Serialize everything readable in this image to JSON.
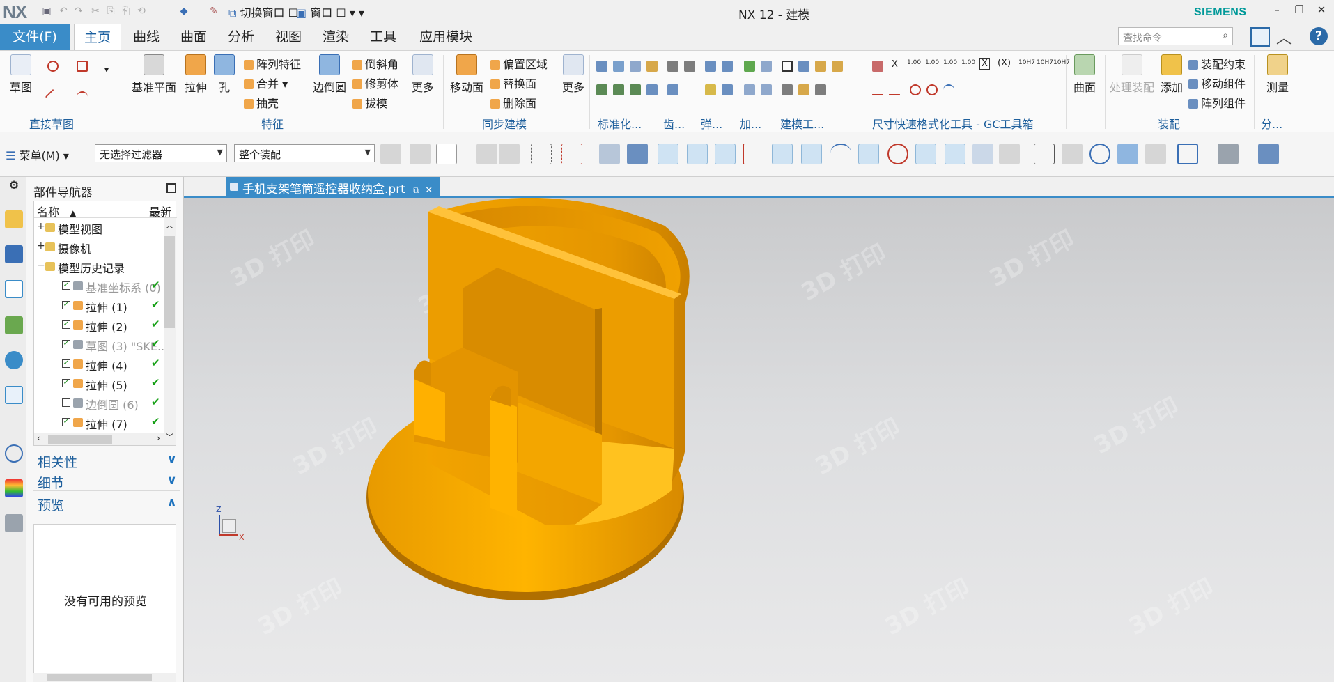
{
  "titlebar": {
    "logo": "NX",
    "switch_window": "切换窗口",
    "window_menu": "窗口",
    "title": "NX 12 - 建模",
    "brand": "SIEMENS"
  },
  "menu_tabs": {
    "file": "文件(F)",
    "tabs": [
      "主页",
      "曲线",
      "曲面",
      "分析",
      "视图",
      "渲染",
      "工具",
      "应用模块"
    ],
    "active": "主页",
    "search_placeholder": "查找命令"
  },
  "ribbon": {
    "groups": [
      "直接草图",
      "特征",
      "同步建模",
      "标准化...",
      "齿...",
      "弹...",
      "加...",
      "建模工...",
      "尺寸快速格式化工具 - GC工具箱",
      "装配",
      "分..."
    ],
    "sketch": "草图",
    "feature": {
      "datum_plane": "基准平面",
      "extrude": "拉伸",
      "hole": "孔",
      "pattern_feature": "阵列特征",
      "unite": "合并",
      "shell": "抽壳",
      "edge_blend": "边倒圆",
      "chamfer": "倒斜角",
      "trim_body": "修剪体",
      "draft": "拔模",
      "more": "更多"
    },
    "sync": {
      "move_face": "移动面",
      "offset_region": "偏置区域",
      "replace_face": "替换面",
      "delete_face": "删除面",
      "more": "更多"
    },
    "surface": "曲面",
    "assembly": {
      "process": "处理装配",
      "add": "添加",
      "constraint": "装配约束",
      "move_component": "移动组件",
      "pattern_component": "阵列组件"
    },
    "measure": "测量"
  },
  "toolbar2": {
    "menu": "菜单(M)",
    "filter": "无选择过滤器",
    "scope": "整个装配"
  },
  "navigator": {
    "title": "部件导航器",
    "col_name": "名称",
    "col_latest": "最新",
    "rows": [
      {
        "sign": "+",
        "label": "模型视图",
        "checked": null,
        "dim": false,
        "ok": false
      },
      {
        "sign": "+",
        "label": "摄像机",
        "checked": null,
        "dim": false,
        "ok": false
      },
      {
        "sign": "−",
        "label": "模型历史记录",
        "checked": null,
        "dim": false,
        "ok": false
      },
      {
        "sign": "",
        "label": "基准坐标系 (0)",
        "checked": true,
        "dim": true,
        "ok": true
      },
      {
        "sign": "",
        "label": "拉伸 (1)",
        "checked": true,
        "dim": false,
        "ok": true
      },
      {
        "sign": "",
        "label": "拉伸 (2)",
        "checked": true,
        "dim": false,
        "ok": true
      },
      {
        "sign": "",
        "label": "草图 (3) \"SKE...",
        "checked": true,
        "dim": true,
        "ok": true
      },
      {
        "sign": "",
        "label": "拉伸 (4)",
        "checked": true,
        "dim": false,
        "ok": true
      },
      {
        "sign": "",
        "label": "拉伸 (5)",
        "checked": true,
        "dim": false,
        "ok": true
      },
      {
        "sign": "",
        "label": "边倒圆 (6)",
        "checked": false,
        "dim": true,
        "ok": true
      },
      {
        "sign": "",
        "label": "拉伸 (7)",
        "checked": true,
        "dim": false,
        "ok": true
      }
    ],
    "panels": {
      "dependencies": "相关性",
      "details": "细节",
      "preview": "预览"
    },
    "preview_text": "没有可用的预览"
  },
  "document": {
    "tab_label": "手机支架笔筒遥控器收纳盒.prt"
  },
  "viewport": {
    "model_color": "#F5A800",
    "axis_z": "Z",
    "axis_x": "X"
  }
}
